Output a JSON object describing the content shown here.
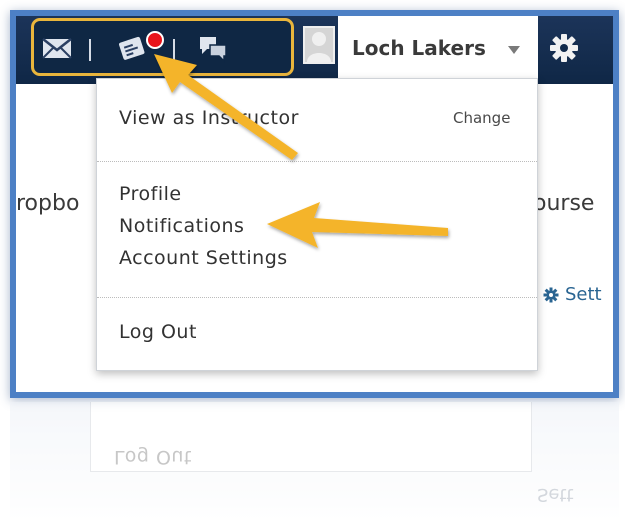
{
  "header": {
    "username": "Loch Lakers"
  },
  "menu": {
    "view_as": "View as Instructor",
    "change": "Change",
    "profile": "Profile",
    "notifications": "Notifications",
    "account_settings": "Account Settings",
    "logout": "Log Out"
  },
  "background": {
    "left_text": "ropbo",
    "right_text": "ourse",
    "settings_partial": "Sett"
  },
  "reflection": {
    "logout_text": "Log Out"
  },
  "icons": [
    "mail-icon",
    "updates-icon",
    "subscriptions-icon",
    "avatar",
    "chevron-down-icon",
    "gear-icon"
  ],
  "colors": {
    "navbar": "#0f2746",
    "frame_border": "#4d80c5",
    "highlight": "#e9b53c",
    "arrow": "#f4b429",
    "badge": "#e8141c"
  }
}
